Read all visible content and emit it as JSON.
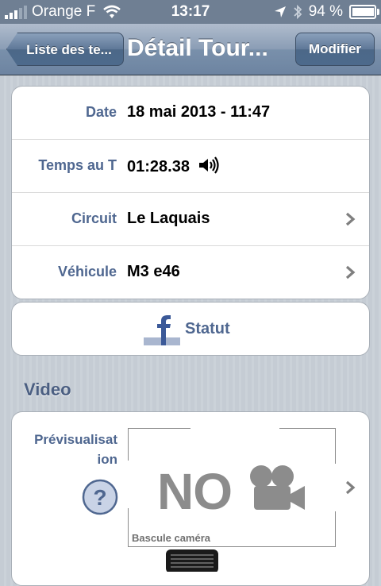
{
  "status_bar": {
    "carrier": "Orange F",
    "time": "13:17",
    "battery": "94 %",
    "battery_level": 0.94,
    "icons": [
      "signal-icon",
      "wifi-icon",
      "location-arrow-icon",
      "bluetooth-icon",
      "battery-icon"
    ]
  },
  "nav": {
    "back_label": "Liste des te...",
    "title": "Détail Tour...",
    "edit_label": "Modifier"
  },
  "details": [
    {
      "label": "Date",
      "value": "18 mai 2013 - 11:47"
    },
    {
      "label": "Temps au T",
      "value": "01:28.38"
    },
    {
      "label": "Circuit",
      "value": "Le Laquais"
    },
    {
      "label": "Véhicule",
      "value": "M3 e46"
    }
  ],
  "facebook": {
    "label": "Statut"
  },
  "video": {
    "section_title": "Video",
    "preview_label": "Prévisualisat ion",
    "no_preview_text": "NO",
    "switch_camera_label": "Bascule caméra"
  },
  "colors": {
    "background": "#c5ccd4",
    "label_blue": "#4f6790",
    "nav_bar": "#7990ab"
  }
}
